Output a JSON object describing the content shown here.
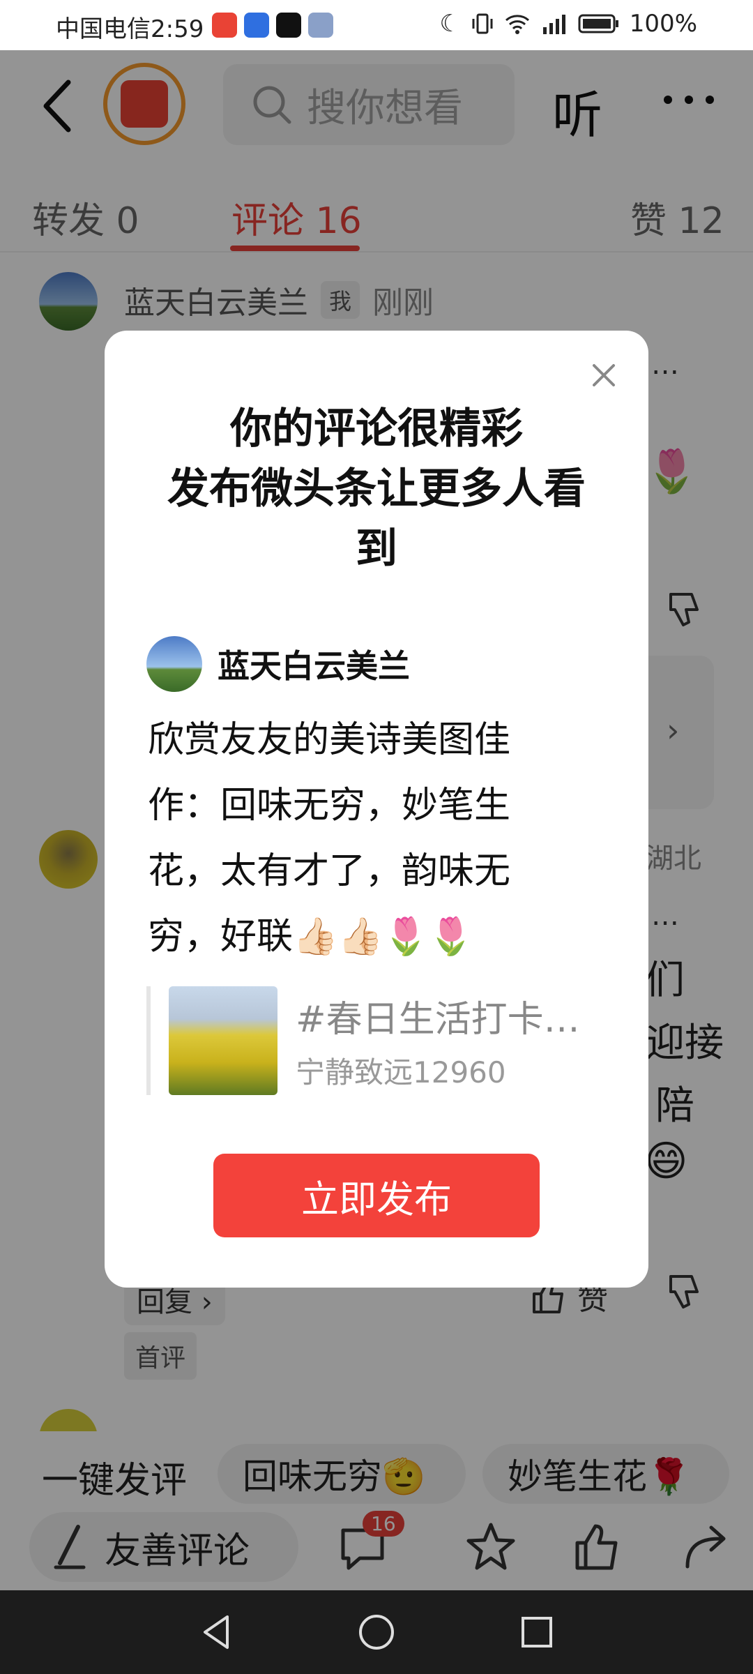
{
  "status": {
    "carrier_time": "中国电信2:59",
    "battery": "100%"
  },
  "header": {
    "search_placeholder": "搜你想看",
    "listen_label": "听"
  },
  "tabs": [
    {
      "label": "转发 0"
    },
    {
      "label": "评论 16"
    },
    {
      "label": "赞 12"
    }
  ],
  "comments": {
    "first": {
      "author": "蓝天白云美兰",
      "badge": "我",
      "time": "刚刚"
    },
    "second": {
      "location": "湖北",
      "partial_lines": [
        "们",
        "迎接",
        "陪"
      ],
      "reply_label": "回复",
      "like_label": "赞",
      "first_comment_badge": "首评"
    }
  },
  "modal": {
    "title_line1": "你的评论很精彩",
    "title_line2": "发布微头条让更多人看",
    "title_line3": "到",
    "author": "蓝天白云美兰",
    "comment_text": "欣赏友友的美诗美图佳作：回味无穷，妙笔生花，太有才了，韵味无穷，好联👍🏻👍🏻🌷🌷",
    "quote_title": "#春日生活打卡…",
    "quote_author": "宁静致远12960",
    "publish_label": "立即发布"
  },
  "quick_comments": {
    "label": "一键发评",
    "chips": [
      "回味无穷🫡",
      "妙笔生花🌹"
    ]
  },
  "bottom_bar": {
    "write_label": "友善评论",
    "comment_count": "16"
  },
  "colors": {
    "accent": "#e8403a",
    "publish_button": "#f3423b",
    "nav_background": "#1c1c1c"
  }
}
